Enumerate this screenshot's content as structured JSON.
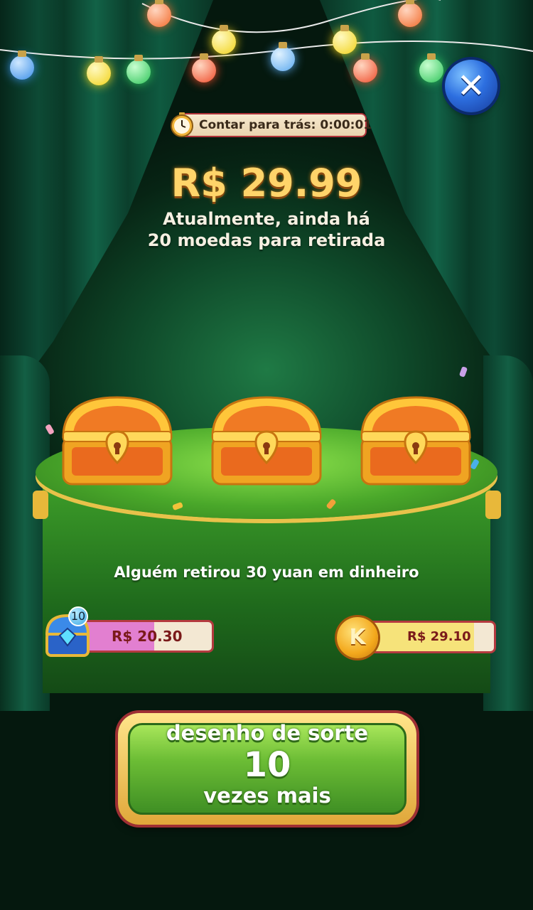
{
  "close_button": {
    "symbol": "✕"
  },
  "countdown": {
    "label": "Contar para trás: 0:00:01"
  },
  "reward": {
    "amount": "R$ 29.99",
    "line1": "Atualmente, ainda há",
    "line2": "20 moedas para retirada"
  },
  "announcement": "Alguém retirou 30 yuan em dinheiro",
  "left_progress": {
    "badge": "10",
    "value_label": "R$ 20.30",
    "fill_fraction": 0.55,
    "color": "#e27fd0"
  },
  "right_progress": {
    "coin_letter": "K",
    "value_label": "R$ 29.10",
    "fill_fraction": 0.85,
    "color": "#f6e37a"
  },
  "draw_button": {
    "line1": "desenho de sorte",
    "count": "10",
    "line2": "vezes mais"
  },
  "colors": {
    "accent_gold": "#ffd46a",
    "button_green": "#6cbd35",
    "border_red": "#b43a3f"
  }
}
